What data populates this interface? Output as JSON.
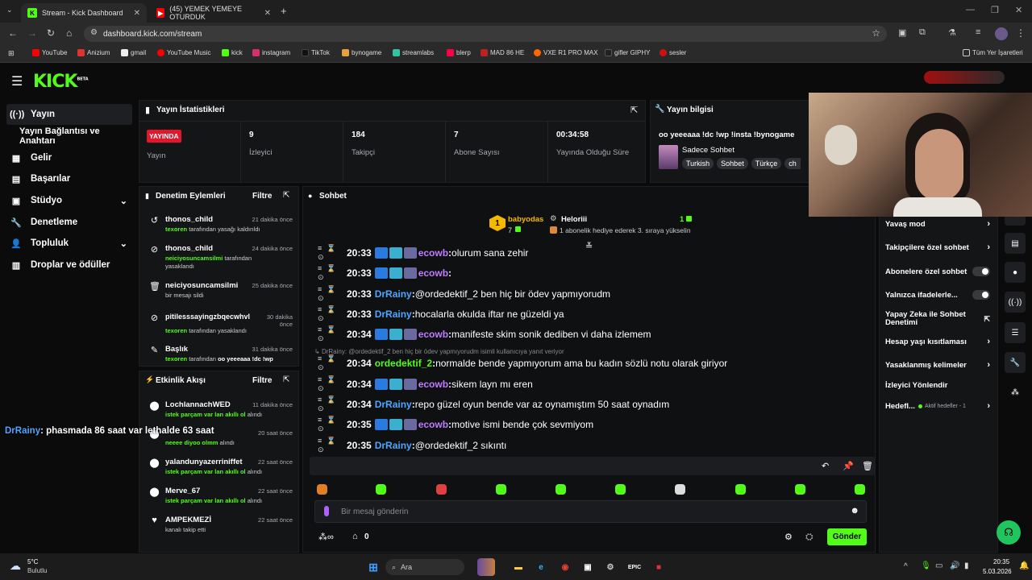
{
  "browser": {
    "tabs": [
      {
        "label": "Stream - Kick Dashboard"
      },
      {
        "label": "(45) YEMEK YEMEYE OTURDUK"
      }
    ],
    "url": "dashboard.kick.com/stream",
    "bookmarks": [
      "YouTube",
      "Anizium",
      "gmail",
      "YouTube Music",
      "kick",
      "instagram",
      "TikTok",
      "bynogame",
      "streamlabs",
      "blerp",
      "MAD 86 HE",
      "VXE R1 PRO MAX",
      "gifler GIPHY",
      "sesler"
    ],
    "all_bookmarks": "Tüm Yer İşaretleri"
  },
  "brand": {
    "logo": "KICK",
    "beta": "BETA",
    "accent": "#53fc18"
  },
  "sidebar": {
    "items": [
      {
        "label": "Yayın",
        "icon": "broadcast-icon"
      },
      {
        "label": "Yayın Bağlantısı ve Anahtarı",
        "icon": ""
      },
      {
        "label": "Gelir",
        "icon": "revenue-icon"
      },
      {
        "label": "Başarılar",
        "icon": "achievements-icon"
      },
      {
        "label": "Stüdyo",
        "icon": "studio-icon"
      },
      {
        "label": "Denetleme",
        "icon": "moderation-icon"
      },
      {
        "label": "Topluluk",
        "icon": "community-icon"
      },
      {
        "label": "Droplar ve ödüller",
        "icon": "drops-icon"
      }
    ]
  },
  "stats": {
    "title": "Yayın İstatistikleri",
    "live_badge": "YAYINDA",
    "live_label": "Yayın",
    "viewers": "9",
    "viewers_label": "İzleyici",
    "followers": "184",
    "followers_label": "Takipçi",
    "subs": "7",
    "subs_label": "Abone Sayısı",
    "uptime": "00:34:58",
    "uptime_label": "Yayında Olduğu Süre"
  },
  "stream_info": {
    "title": "Yayın bilgisi",
    "stream_title": "oo yeeeaaa !dc !wp !insta !bynogame",
    "category": "Sadece Sohbet",
    "tags": [
      "Turkish",
      "Sohbet",
      "Türkçe",
      "ch"
    ]
  },
  "mod_actions": {
    "title": "Denetim Eylemleri",
    "filter": "Filtre",
    "items": [
      {
        "name": "thonos_child",
        "actor": "texoren",
        "text": "tarafından yasağı kaldırıldı",
        "time": "21 dakika önce"
      },
      {
        "name": "thonos_child",
        "actor": "neiciyosuncamsilmi",
        "text": "tarafından yasaklandı",
        "time": "24 dakika önce"
      },
      {
        "name": "neiciyosuncamsilmi",
        "actor": "",
        "text": "bir mesajı sildi",
        "time": "25 dakika önce"
      },
      {
        "name": "pitilesssayingzbqecwhvl",
        "actor": "texoren",
        "text": "tarafından yasaklandı",
        "time": "30 dakika önce"
      },
      {
        "name": "Başlık",
        "actor": "texoren",
        "text": "tarafından",
        "extra": "oo yeeeaaa !dc !wp",
        "time": "31 dakika önce"
      }
    ]
  },
  "activity": {
    "title": "Etkinlik Akışı",
    "filter": "Filtre",
    "items": [
      {
        "name": "LochlannachWED",
        "line": "istek parçam var lan akıllı ol",
        "suffix": "alındı",
        "time": "11 dakika önce"
      },
      {
        "name": "",
        "line": "neeee diyoo olmm",
        "suffix": "alındı",
        "time": "20 saat önce"
      },
      {
        "name": "yalandunyazerriniffet",
        "line": "istek parçam var lan akıllı ol",
        "suffix": "alındı",
        "time": "22 saat önce"
      },
      {
        "name": "Merve_67",
        "line": "istek parçam var lan akıllı ol",
        "suffix": "alındı",
        "time": "22 saat önce"
      },
      {
        "name": "AMPEKMEZİ",
        "line": "kanalı takip etti",
        "suffix": "",
        "time": "22 saat önce"
      }
    ]
  },
  "overlay_msg": {
    "user": "DrRainy",
    "text": ": phasmada 86 saat var lethalde 63 saat"
  },
  "chat": {
    "title": "Sohbet",
    "top_gifter": {
      "name": "babyodas",
      "count": "7",
      "rank": "1"
    },
    "gift_event": {
      "name": "Heloriii",
      "text": "1 abonelik hediye ederek 3. sıraya yükselin",
      "count": "1"
    },
    "messages": [
      {
        "time": "20:33",
        "user": "ecowb",
        "color": "#c07cff",
        "badges": true,
        "text": "olurum sana zehir"
      },
      {
        "time": "20:33",
        "user": "ecowb",
        "color": "#c07cff",
        "badges": true,
        "text": ""
      },
      {
        "time": "20:33",
        "user": "DrRainy",
        "color": "#4ea6ff",
        "badges": false,
        "text": "@ordedektif_2 ben hiç bir ödev yapmıyorudm"
      },
      {
        "time": "20:33",
        "user": "DrRainy",
        "color": "#4ea6ff",
        "badges": false,
        "text": "hocalarla okulda iftar ne güzeldi ya"
      },
      {
        "time": "20:34",
        "user": "ecowb",
        "color": "#c07cff",
        "badges": true,
        "text": "manifeste skim sonik dediben vi daha izlemem"
      },
      {
        "time": "20:34",
        "user": "ordedektif_2",
        "color": "#53fc18",
        "badges": false,
        "text": "normalde bende yapmıyorum ama bu kadın sözlü notu olarak giriyor"
      },
      {
        "time": "20:34",
        "user": "ecowb",
        "color": "#c07cff",
        "badges": true,
        "text": "sikem layn mı eren"
      },
      {
        "time": "20:34",
        "user": "DrRainy",
        "color": "#4ea6ff",
        "badges": false,
        "text": "repo güzel oyun bende var az oynamıştım 50 saat oynadım"
      },
      {
        "time": "20:35",
        "user": "ecowb",
        "color": "#c07cff",
        "badges": true,
        "text": "motive ismi bende çok sevmiyom"
      },
      {
        "time": "20:35",
        "user": "DrRainy",
        "color": "#4ea6ff",
        "badges": false,
        "text": "@ordedektif_2 sıkıntı"
      },
      {
        "time": "20:35",
        "user": "DrRainy",
        "color": "#4ea6ff",
        "badges": false,
        "text": "phasmada 86 saat var lethalde 63 saat"
      }
    ],
    "reply_context": "DrRainy: @ordedektif_2 ben hiç bir ödev yapmıyorudm isimli kullanıcıya yanıt veriyor",
    "input_placeholder": "Bir mesaj gönderin",
    "points": "0",
    "send": "Gönder"
  },
  "chat_settings": {
    "items": [
      {
        "label": "Yavaş mod",
        "type": "arrow"
      },
      {
        "label": "Takipçilere özel sohbet",
        "type": "arrow"
      },
      {
        "label": "Abonelere özel sohbet",
        "type": "toggle"
      },
      {
        "label": "Yalnızca ifadelerle...",
        "type": "toggle"
      },
      {
        "label": "Yapay Zeka ile Sohbet Denetimi",
        "type": "link"
      },
      {
        "label": "Hesap yaşı kısıtlaması",
        "type": "arrow"
      },
      {
        "label": "Yasaklanmış kelimeler",
        "type": "arrow"
      },
      {
        "label": "İzleyici Yönlendir",
        "type": "none"
      },
      {
        "label": "Hedefl...",
        "type": "arrow",
        "extra": "Aktif hedefler - 1"
      }
    ]
  },
  "taskbar": {
    "weather_temp": "5°C",
    "weather_desc": "Bulutlu",
    "search": "Ara",
    "time": "20:35",
    "date": "5.03.2026"
  }
}
